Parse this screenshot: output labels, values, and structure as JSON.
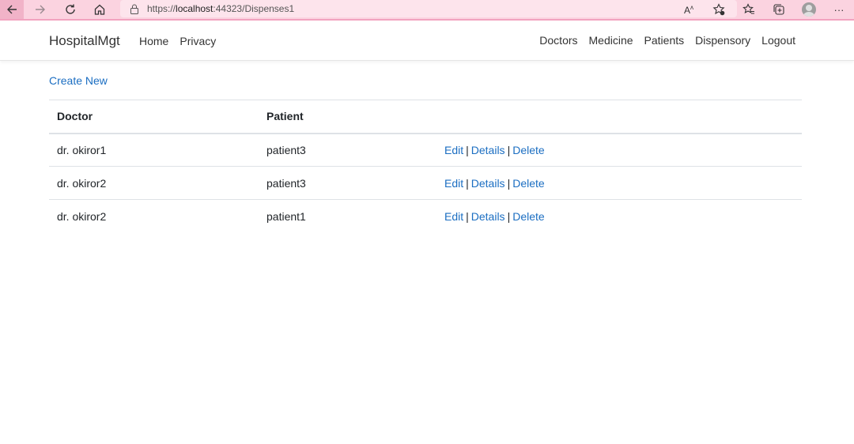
{
  "browser": {
    "url_prefix": "https://",
    "url_host": "localhost",
    "url_rest": ":44323/Dispenses1"
  },
  "navbar": {
    "brand": "HospitalMgt",
    "left": [
      "Home",
      "Privacy"
    ],
    "right": [
      "Doctors",
      "Medicine",
      "Patients",
      "Dispensory",
      "Logout"
    ]
  },
  "main": {
    "create_new": "Create New",
    "columns": [
      "Doctor",
      "Patient"
    ],
    "rows": [
      {
        "doctor": "dr. okiror1",
        "patient": "patient3"
      },
      {
        "doctor": "dr. okiror2",
        "patient": "patient3"
      },
      {
        "doctor": "dr. okiror2",
        "patient": "patient1"
      }
    ],
    "actions": {
      "edit": "Edit",
      "details": "Details",
      "delete": "Delete",
      "separator": "|"
    }
  },
  "colors": {
    "link": "#1b6ec2",
    "browser_bar": "#fbd3e0"
  }
}
